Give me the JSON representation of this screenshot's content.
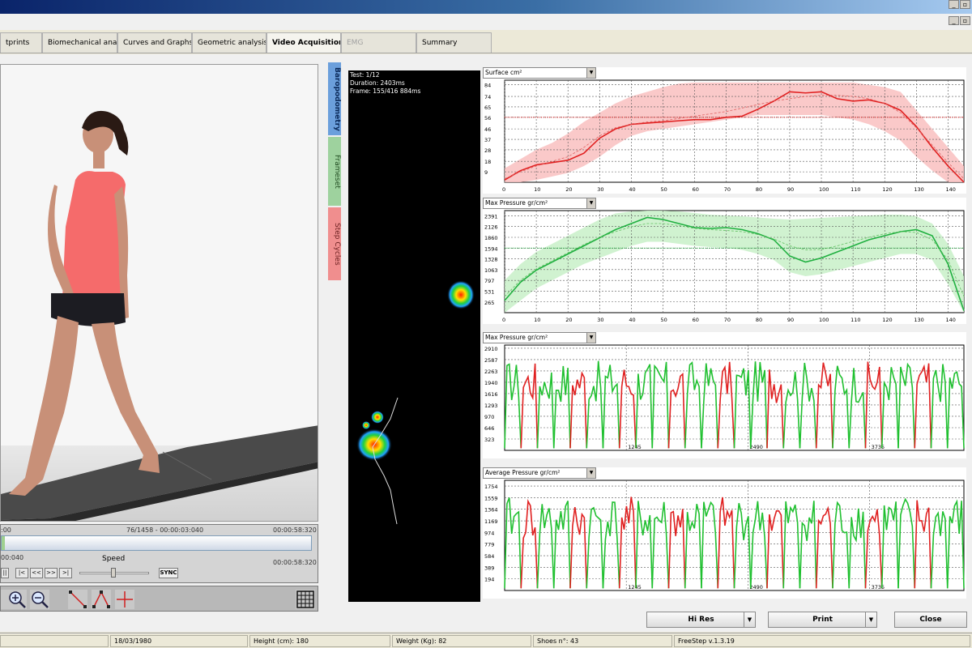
{
  "window": {
    "buttons": [
      "_",
      "▫"
    ]
  },
  "tabs": [
    {
      "label": "tprints",
      "state": "normal"
    },
    {
      "label": "Biomechanical analysis",
      "state": "normal"
    },
    {
      "label": "Curves and Graphs",
      "state": "normal"
    },
    {
      "label": "Geometric analysis",
      "state": "normal"
    },
    {
      "label": "Video Acquisition",
      "state": "active"
    },
    {
      "label": "EMG",
      "state": "disabled"
    },
    {
      "label": "Summary",
      "state": "normal"
    }
  ],
  "player": {
    "frame_info": "76/1458 - 00:00:03:040",
    "total_time_top": "00:00:58:320",
    "start_time_left": ":00",
    "current_time": "00:040",
    "speed_label": "Speed",
    "total_time_bottom": "00:00:58:320",
    "sync_label": "SYNC",
    "transport": [
      "||",
      "|<",
      "<<",
      ">>",
      ">|"
    ]
  },
  "side_tabs": [
    {
      "label": "Baropodometry",
      "color": "#6b9fdc"
    },
    {
      "label": "Frameset",
      "color": "#9ed29e"
    },
    {
      "label": "Step Cycles",
      "color": "#f08e8e"
    }
  ],
  "test_info": {
    "test": "Test: 1/12",
    "duration": "Duration: 2403ms",
    "frame": "Frame: 155/416 884ms"
  },
  "charts": [
    {
      "dropdown": "Surface cm²"
    },
    {
      "dropdown": "Max Pressure gr/cm²"
    },
    {
      "dropdown": "Max Pressure gr/cm²"
    },
    {
      "dropdown": "Average Pressure gr/cm²"
    }
  ],
  "buttons": {
    "hires": "Hi Res",
    "print": "Print",
    "close": "Close"
  },
  "status": {
    "dob": "18/03/1980",
    "height": "Height (cm): 180",
    "weight": "Weight (Kg): 82",
    "shoes": "Shoes n°: 43",
    "version": "FreeStep v.1.3.19"
  },
  "chart_data": [
    {
      "type": "line",
      "title": "Surface cm²",
      "x_ticks": [
        "0",
        "10",
        "20",
        "30",
        "40",
        "50",
        "60",
        "70",
        "80",
        "90",
        "100",
        "110",
        "120",
        "130",
        "140"
      ],
      "y_ticks": [
        "9",
        "18",
        "28",
        "37",
        "46",
        "56",
        "65",
        "74",
        "84"
      ],
      "xlim": [
        0,
        145
      ],
      "ylim": [
        0,
        88
      ],
      "x": [
        0,
        5,
        10,
        15,
        20,
        25,
        30,
        35,
        40,
        45,
        50,
        55,
        60,
        65,
        70,
        75,
        80,
        85,
        90,
        95,
        100,
        105,
        110,
        115,
        120,
        125,
        130,
        135,
        140,
        145
      ],
      "series": [
        {
          "color": "#e02020",
          "values": [
            2,
            10,
            15,
            17,
            19,
            25,
            38,
            46,
            50,
            51,
            52,
            53,
            54,
            54,
            56,
            57,
            63,
            70,
            78,
            77,
            78,
            72,
            70,
            71,
            68,
            62,
            48,
            30,
            14,
            0
          ]
        },
        {
          "color": "#e06060",
          "dashed": true,
          "values": [
            3,
            9,
            14,
            18,
            22,
            30,
            40,
            47,
            50,
            52,
            53,
            55,
            57,
            59,
            61,
            64,
            67,
            70,
            72,
            74,
            75,
            75,
            74,
            72,
            68,
            60,
            47,
            32,
            17,
            3
          ]
        }
      ],
      "band": {
        "color": "#f9c0c0",
        "upper": [
          12,
          20,
          28,
          34,
          42,
          52,
          60,
          68,
          74,
          78,
          82,
          85,
          86,
          86,
          86,
          86,
          86,
          86,
          86,
          86,
          86,
          86,
          86,
          84,
          82,
          78,
          62,
          46,
          30,
          14
        ],
        "lower": [
          0,
          0,
          2,
          5,
          8,
          14,
          22,
          32,
          40,
          44,
          46,
          48,
          50,
          52,
          54,
          56,
          58,
          58,
          58,
          58,
          58,
          56,
          54,
          50,
          44,
          36,
          22,
          10,
          0,
          0
        ]
      },
      "reference_line": 56
    },
    {
      "type": "line",
      "title": "Max Pressure gr/cm²",
      "x_ticks": [
        "0",
        "10",
        "20",
        "30",
        "40",
        "50",
        "60",
        "70",
        "80",
        "90",
        "100",
        "110",
        "120",
        "130",
        "140"
      ],
      "y_ticks": [
        "265",
        "531",
        "797",
        "1063",
        "1328",
        "1594",
        "1860",
        "2126",
        "2391"
      ],
      "xlim": [
        0,
        145
      ],
      "ylim": [
        0,
        2520
      ],
      "x": [
        0,
        5,
        10,
        15,
        20,
        25,
        30,
        35,
        40,
        45,
        50,
        55,
        60,
        65,
        70,
        75,
        80,
        85,
        90,
        95,
        100,
        105,
        110,
        115,
        120,
        125,
        130,
        135,
        140,
        145
      ],
      "series": [
        {
          "color": "#20b040",
          "values": [
            300,
            750,
            1050,
            1250,
            1450,
            1650,
            1850,
            2050,
            2200,
            2350,
            2300,
            2200,
            2100,
            2080,
            2100,
            2050,
            1950,
            1800,
            1400,
            1250,
            1350,
            1500,
            1650,
            1800,
            1900,
            2000,
            2050,
            1900,
            1200,
            50
          ]
        },
        {
          "color": "#60c060",
          "dashed": true,
          "values": [
            400,
            800,
            1080,
            1280,
            1480,
            1680,
            1860,
            2000,
            2120,
            2200,
            2200,
            2150,
            2080,
            2050,
            2030,
            2000,
            1930,
            1820,
            1650,
            1550,
            1560,
            1650,
            1760,
            1860,
            1950,
            2000,
            1980,
            1800,
            1300,
            400
          ]
        }
      ],
      "band": {
        "color": "#c8f0c8",
        "upper": [
          800,
          1200,
          1500,
          1700,
          1900,
          2100,
          2300,
          2450,
          2500,
          2520,
          2520,
          2500,
          2460,
          2420,
          2400,
          2380,
          2350,
          2320,
          2300,
          2320,
          2340,
          2360,
          2380,
          2400,
          2420,
          2420,
          2380,
          2200,
          1700,
          900
        ],
        "lower": [
          0,
          300,
          600,
          800,
          1000,
          1200,
          1350,
          1500,
          1650,
          1750,
          1750,
          1700,
          1650,
          1620,
          1600,
          1550,
          1450,
          1300,
          1000,
          900,
          950,
          1050,
          1150,
          1250,
          1350,
          1450,
          1450,
          1300,
          700,
          0
        ]
      },
      "reference_line": 1594
    },
    {
      "type": "line",
      "title": "Max Pressure gr/cm²",
      "y_ticks": [
        "323",
        "646",
        "970",
        "1293",
        "1616",
        "1940",
        "2263",
        "2587",
        "2910"
      ],
      "x_ticks": [
        "1245",
        "2490",
        "3735"
      ],
      "ylim": [
        0,
        3000
      ],
      "xlim": [
        0,
        4700
      ],
      "note": "Gait cycles alternating green/red traces"
    },
    {
      "type": "line",
      "title": "Average Pressure gr/cm²",
      "y_ticks": [
        "194",
        "389",
        "584",
        "779",
        "974",
        "1169",
        "1364",
        "1559",
        "1754"
      ],
      "x_ticks": [
        "1245",
        "2490",
        "3735"
      ],
      "ylim": [
        0,
        1850
      ],
      "xlim": [
        0,
        4700
      ],
      "note": "Gait cycles alternating green/red traces"
    }
  ]
}
